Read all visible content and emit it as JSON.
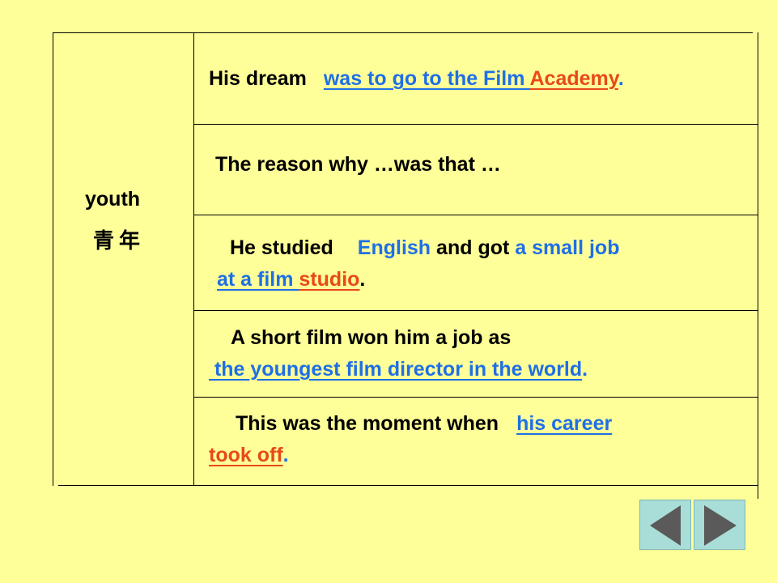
{
  "left_cell": {
    "title": "youth",
    "subtitle": "青年"
  },
  "rows": [
    {
      "prefix": "His dream",
      "answer_blue": "was to go to the Film ",
      "answer_red": "Academy",
      "suffix": "."
    },
    {
      "text": "The reason why …was that …"
    },
    {
      "prefix": "He studied",
      "blue1": "English",
      "mid": "and got",
      "blue2": "a small job",
      "line2_blue": "at a film ",
      "line2_red": "studio",
      "suffix": "."
    },
    {
      "text": "A short film won him a job as",
      "line2_blue": " the youngest film director in the world",
      "suffix": "."
    },
    {
      "text": "This was the moment when",
      "blue": "his career",
      "line2_red": "took off",
      "suffix": "."
    }
  ],
  "nav": {
    "prev_icon": "triangle-left-icon",
    "next_icon": "triangle-right-icon"
  },
  "colors": {
    "background": "#ffff99",
    "answer_blue": "#1f6fe6",
    "answer_red": "#e8491b",
    "nav_button": "#a9ded8",
    "nav_arrow": "#5a5a5a"
  }
}
